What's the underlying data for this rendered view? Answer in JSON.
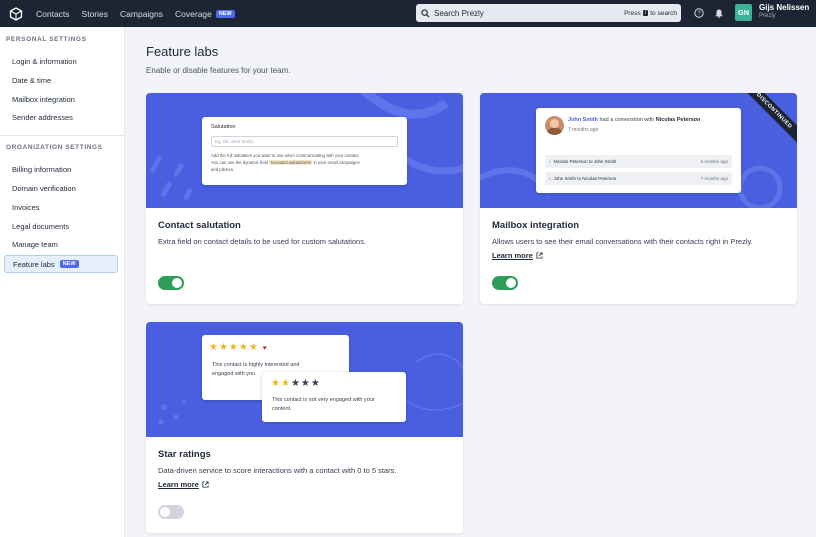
{
  "topbar": {
    "nav": [
      "Contacts",
      "Stories",
      "Campaigns",
      "Coverage"
    ],
    "coverage_badge": "NEW",
    "search_placeholder": "Search Prezly",
    "search_hint_pre": "Press",
    "search_hint_key": "/",
    "search_hint_post": "to search",
    "user_initials": "GN",
    "user_name": "Gijs Nelissen",
    "user_org": "Prezly"
  },
  "sidebar": {
    "personal_heading": "PERSONAL SETTINGS",
    "personal_items": [
      "Login & information",
      "Date & time",
      "Mailbox integration",
      "Sender addresses"
    ],
    "org_heading": "ORGANIZATION SETTINGS",
    "org_items": [
      "Billing information",
      "Domain verification",
      "Invoices",
      "Legal documents",
      "Manage team"
    ],
    "active_item": "Feature labs",
    "active_badge": "NEW"
  },
  "main": {
    "title": "Feature labs",
    "subtitle": "Enable or disable features for your team."
  },
  "cards": [
    {
      "title": "Contact salutation",
      "description": "Extra field on contact details to be used for custom salutations.",
      "enabled": true,
      "mock": {
        "label": "Salutation",
        "placeholder": "Eg. Mr. John Smith",
        "help_1": "Add the full salutation you want to use when communicating with your contact.",
        "help_2a": "You can use the dynamic field",
        "help_2b": "%contact.salutation%",
        "help_2c": "in your email campaigns",
        "help_3": "and pitches."
      }
    },
    {
      "title": "Mailbox integration",
      "description": "Allows users to see their email conversations with their contacts right in Prezly.",
      "link": "Learn more",
      "enabled": true,
      "ribbon": "DISCONTINUED",
      "mock": {
        "name": "John Smith",
        "action": "had a converstion with",
        "other": "Nicolas Peterson",
        "when": "7 months ago",
        "rows": [
          {
            "text": "Nicolas Peterson to John Smith",
            "time": "6 months ago"
          },
          {
            "text": "John Smith to Nicolas Peterson",
            "time": "7 months ago"
          }
        ]
      }
    },
    {
      "title": "Star ratings",
      "description": "Data-driven service to score interactions with a contact with 0 to 5 stars.",
      "link": "Learn more",
      "enabled": false,
      "mock": {
        "rating_high": 5,
        "text_high_1": "This contact is highly interested and",
        "text_high_2": "engaged with you",
        "rating_low": 2,
        "text_low_1": "This contact is not very engaged with your",
        "text_low_2": "content."
      }
    }
  ],
  "colors": {
    "topbar": "#1d2433",
    "hero": "#4a5fe0",
    "toggle_on": "#2e9d57",
    "badge": "#4f6af0"
  }
}
